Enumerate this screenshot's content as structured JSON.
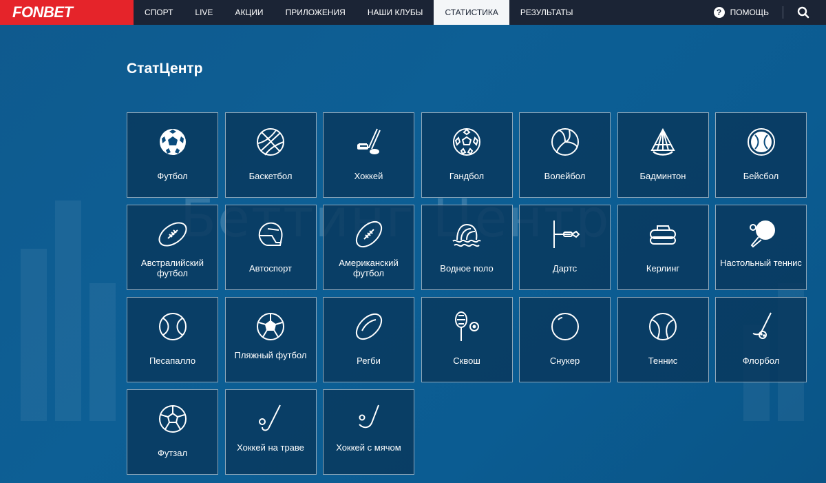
{
  "header": {
    "logo": "FONBET",
    "nav": [
      "СПОРТ",
      "LIVE",
      "АКЦИИ",
      "ПРИЛОЖЕНИЯ",
      "НАШИ КЛУБЫ",
      "СТАТИСТИКА",
      "РЕЗУЛЬТАТЫ"
    ],
    "active_nav": "СТАТИСТИКА",
    "help_label": "ПОМОЩЬ",
    "help_icon": "question-icon",
    "search_icon": "search-icon"
  },
  "background": {
    "watermark": "Беттинг Центр"
  },
  "page_title": "СтатЦентр",
  "sports": [
    {
      "label": "Футбол",
      "icon": "soccer-ball-icon"
    },
    {
      "label": "Баскетбол",
      "icon": "basketball-icon"
    },
    {
      "label": "Хоккей",
      "icon": "hockey-stick-icon"
    },
    {
      "label": "Гандбол",
      "icon": "handball-icon"
    },
    {
      "label": "Волейбол",
      "icon": "volleyball-icon"
    },
    {
      "label": "Бадминтон",
      "icon": "shuttlecock-icon"
    },
    {
      "label": "Бейсбол",
      "icon": "baseball-icon"
    },
    {
      "label": "Австралийский футбол",
      "icon": "aussie-football-icon"
    },
    {
      "label": "Автоспорт",
      "icon": "helmet-icon"
    },
    {
      "label": "Американский футбол",
      "icon": "american-football-icon"
    },
    {
      "label": "Водное поло",
      "icon": "water-polo-icon"
    },
    {
      "label": "Дартс",
      "icon": "dart-icon"
    },
    {
      "label": "Керлинг",
      "icon": "curling-stone-icon"
    },
    {
      "label": "Настольный теннис",
      "icon": "ping-pong-icon"
    },
    {
      "label": "Песапалло",
      "icon": "pesapallo-ball-icon"
    },
    {
      "label": "Пляжный футбол",
      "icon": "beach-soccer-icon"
    },
    {
      "label": "Регби",
      "icon": "rugby-ball-icon"
    },
    {
      "label": "Сквош",
      "icon": "squash-racket-icon"
    },
    {
      "label": "Снукер",
      "icon": "snooker-ball-icon"
    },
    {
      "label": "Теннис",
      "icon": "tennis-ball-icon"
    },
    {
      "label": "Флорбол",
      "icon": "floorball-icon"
    },
    {
      "label": "Футзал",
      "icon": "futsal-ball-icon"
    },
    {
      "label": "Хоккей на траве",
      "icon": "field-hockey-icon"
    },
    {
      "label": "Хоккей с мячом",
      "icon": "bandy-icon"
    }
  ],
  "colors": {
    "brand_red": "#e5242a",
    "header_bg": "#1b2435",
    "page_bg": "#0d5f95"
  }
}
